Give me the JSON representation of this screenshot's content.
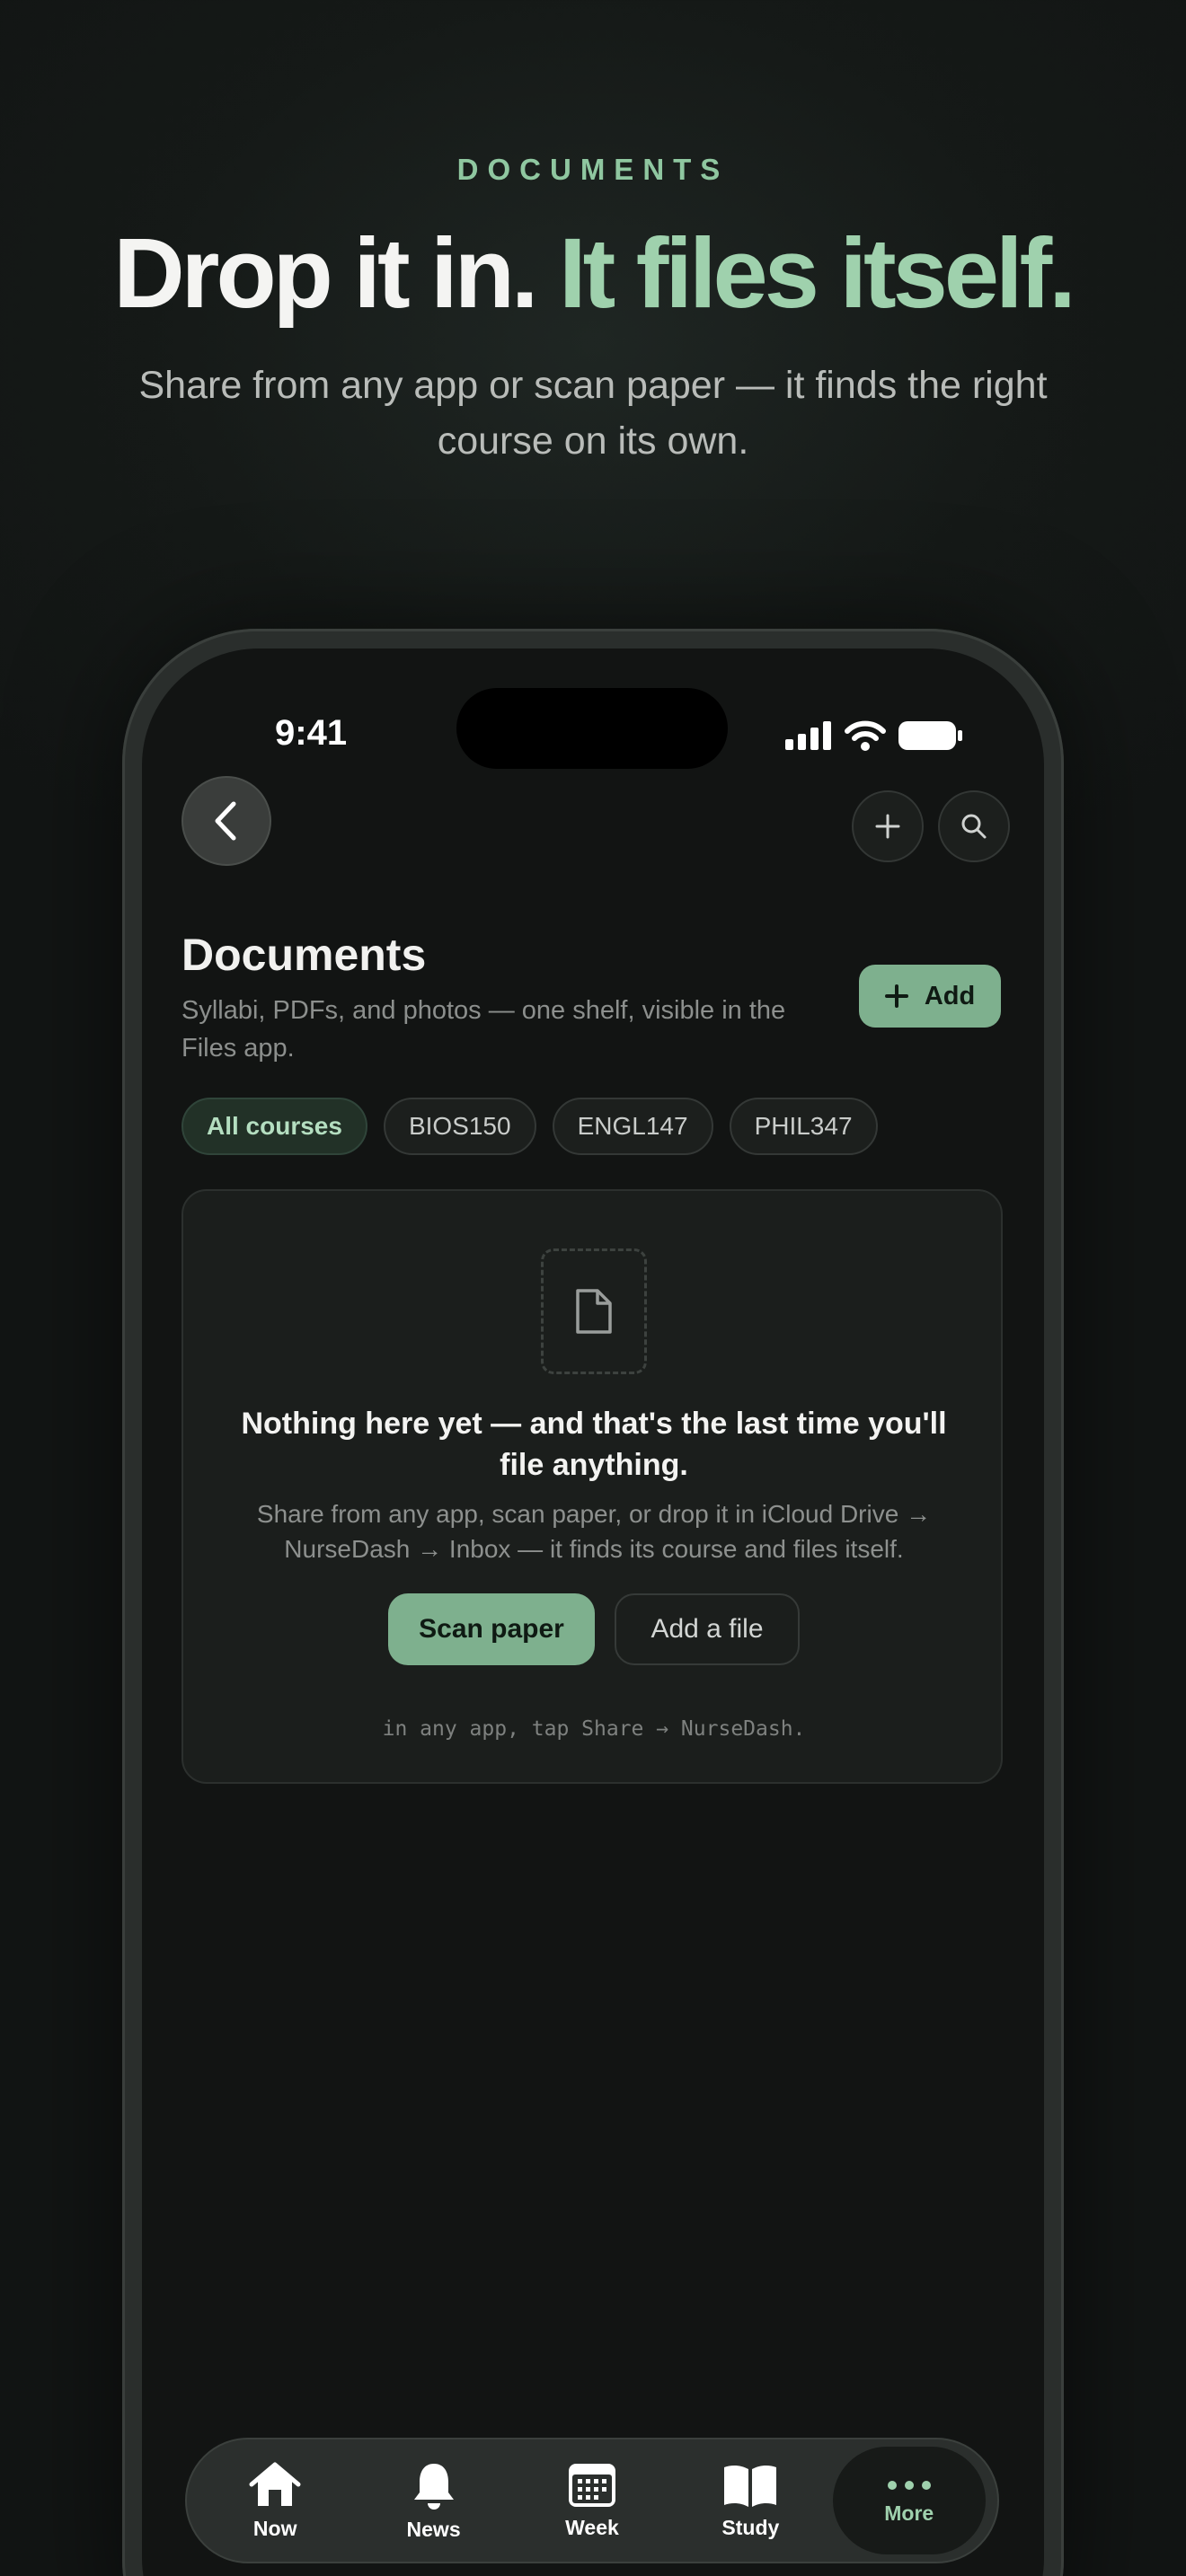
{
  "hero": {
    "eyebrow": "DOCUMENTS",
    "headline_white": "Drop it in.",
    "headline_green": "It files itself.",
    "subhead": "Share from any app or scan paper — it finds the right course on its own."
  },
  "status_bar": {
    "time": "9:41"
  },
  "header": {
    "back_icon": "chevron-left-icon",
    "plus_icon": "plus-icon",
    "search_icon": "search-icon"
  },
  "documents": {
    "title": "Documents",
    "subtitle": "Syllabi, PDFs, and photos — one shelf, visible in the Files app.",
    "add_label": "Add"
  },
  "filters": [
    {
      "label": "All courses",
      "active": true
    },
    {
      "label": "BIOS150",
      "active": false
    },
    {
      "label": "ENGL147",
      "active": false
    },
    {
      "label": "PHIL347",
      "active": false
    }
  ],
  "empty_state": {
    "icon": "document-icon",
    "title": "Nothing here yet — and that's the last time you'll file anything.",
    "description": "Share from any app, scan paper, or drop it in iCloud Drive → NurseDash → Inbox — it finds its course and files itself.",
    "scan_label": "Scan paper",
    "add_file_label": "Add a file",
    "hint": "in any app, tap Share → NurseDash."
  },
  "tabbar": [
    {
      "label": "Now",
      "icon": "home-icon",
      "active": false
    },
    {
      "label": "News",
      "icon": "bell-icon",
      "active": false
    },
    {
      "label": "Week",
      "icon": "calendar-icon",
      "active": false
    },
    {
      "label": "Study",
      "icon": "book-icon",
      "active": false
    },
    {
      "label": "More",
      "icon": "more-icon",
      "active": true
    }
  ],
  "colors": {
    "accent": "#7eb08e",
    "accent_text": "#9fd1ad",
    "background": "#121413"
  }
}
